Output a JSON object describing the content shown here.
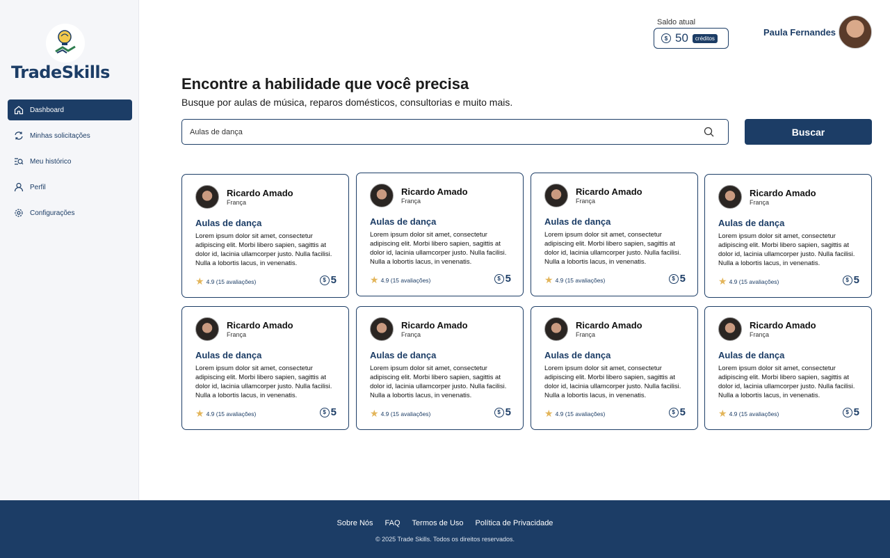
{
  "brand": {
    "name": "TradeSkills"
  },
  "sidebar": {
    "items": [
      {
        "label": "Dashboard",
        "icon": "home-icon",
        "active": true
      },
      {
        "label": "Minhas solicitações",
        "icon": "exchange-icon"
      },
      {
        "label": "Meu histórico",
        "icon": "history-search-icon"
      },
      {
        "label": "Perfil",
        "icon": "user-icon"
      },
      {
        "label": "Configurações",
        "icon": "gear-icon"
      }
    ]
  },
  "header": {
    "saldo_label": "Saldo atual",
    "saldo_value": "50",
    "saldo_unit": "créditos",
    "user_name": "Paula Fernandes"
  },
  "main": {
    "title": "Encontre a habilidade que você precisa",
    "subtitle": "Busque por aulas de música, reparos domésticos, consultorias e muito mais.",
    "search_value": "Aulas de dança",
    "search_button": "Buscar"
  },
  "cards": [
    {
      "name": "Ricardo Amado",
      "country": "França",
      "skill": "Aulas de dança",
      "description": "Lorem ipsum dolor sit amet, consectetur adipiscing elit. Morbi libero sapien, sagittis at dolor id, lacinia ullamcorper justo. Nulla facilisi. Nulla a lobortis lacus, in venenatis.",
      "rating": "4.9 (15 avaliações)",
      "price": "5"
    },
    {
      "name": "Ricardo Amado",
      "country": "França",
      "skill": "Aulas de dança",
      "description": "Lorem ipsum dolor sit amet, consectetur adipiscing elit. Morbi libero sapien, sagittis at dolor id, lacinia ullamcorper justo. Nulla facilisi. Nulla a lobortis lacus, in venenatis.",
      "rating": "4.9 (15 avaliações)",
      "price": "5"
    },
    {
      "name": "Ricardo Amado",
      "country": "França",
      "skill": "Aulas de dança",
      "description": "Lorem ipsum dolor sit amet, consectetur adipiscing elit. Morbi libero sapien, sagittis at dolor id, lacinia ullamcorper justo. Nulla facilisi. Nulla a lobortis lacus, in venenatis.",
      "rating": "4.9 (15 avaliações)",
      "price": "5"
    },
    {
      "name": "Ricardo Amado",
      "country": "França",
      "skill": "Aulas de dança",
      "description": "Lorem ipsum dolor sit amet, consectetur adipiscing elit. Morbi libero sapien, sagittis at dolor id, lacinia ullamcorper justo. Nulla facilisi. Nulla a lobortis lacus, in venenatis.",
      "rating": "4.9 (15 avaliações)",
      "price": "5"
    },
    {
      "name": "Ricardo Amado",
      "country": "França",
      "skill": "Aulas de dança",
      "description": "Lorem ipsum dolor sit amet, consectetur adipiscing elit. Morbi libero sapien, sagittis at dolor id, lacinia ullamcorper justo. Nulla facilisi. Nulla a lobortis lacus, in venenatis.",
      "rating": "4.9 (15 avaliações)",
      "price": "5"
    },
    {
      "name": "Ricardo Amado",
      "country": "França",
      "skill": "Aulas de dança",
      "description": "Lorem ipsum dolor sit amet, consectetur adipiscing elit. Morbi libero sapien, sagittis at dolor id, lacinia ullamcorper justo. Nulla facilisi. Nulla a lobortis lacus, in venenatis.",
      "rating": "4.9 (15 avaliações)",
      "price": "5"
    },
    {
      "name": "Ricardo Amado",
      "country": "França",
      "skill": "Aulas de dança",
      "description": "Lorem ipsum dolor sit amet, consectetur adipiscing elit. Morbi libero sapien, sagittis at dolor id, lacinia ullamcorper justo. Nulla facilisi. Nulla a lobortis lacus, in venenatis.",
      "rating": "4.9 (15 avaliações)",
      "price": "5"
    },
    {
      "name": "Ricardo Amado",
      "country": "França",
      "skill": "Aulas de dança",
      "description": "Lorem ipsum dolor sit amet, consectetur adipiscing elit. Morbi libero sapien, sagittis at dolor id, lacinia ullamcorper justo. Nulla facilisi. Nulla a lobortis lacus, in venenatis.",
      "rating": "4.9 (15 avaliações)",
      "price": "5"
    }
  ],
  "footer": {
    "links": [
      "Sobre Nós",
      "FAQ",
      "Termos de Uso",
      "Política de Privacidade"
    ],
    "copyright": "© 2025 Trade Skills. Todos os direitos reservados."
  },
  "colors": {
    "primary": "#1c3d66",
    "star": "#e3b55a",
    "sidebar_bg": "#f5f6f9"
  }
}
